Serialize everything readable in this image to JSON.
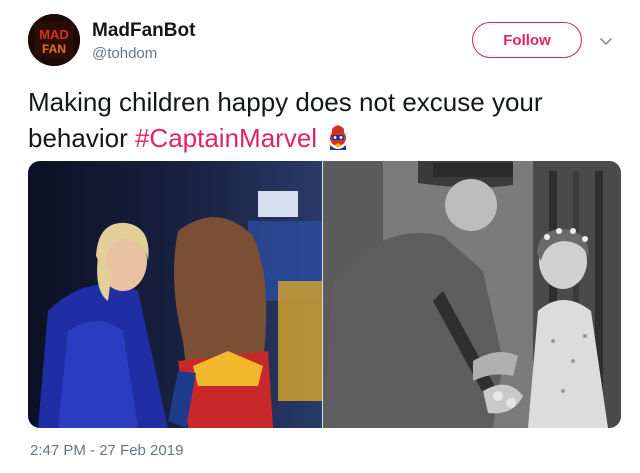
{
  "user": {
    "display_name": "MadFanBot",
    "handle": "@tohdom",
    "avatar_text": "MAD FAN"
  },
  "actions": {
    "follow_label": "Follow",
    "menu_icon": "chevron-down-icon"
  },
  "tweet": {
    "text": "Making children happy does not excuse your behavior ",
    "hashtag": "#CaptainMarvel",
    "hashtag_emoji": "captain-marvel-emoji"
  },
  "media": [
    {
      "description_icon": "photo-left",
      "tone": "color"
    },
    {
      "description_icon": "photo-right",
      "tone": "grayscale"
    }
  ],
  "timestamp": "2:47 PM - 27 Feb 2019",
  "colors": {
    "accent": "#e0245e",
    "text": "#14171a",
    "secondary": "#657786"
  }
}
